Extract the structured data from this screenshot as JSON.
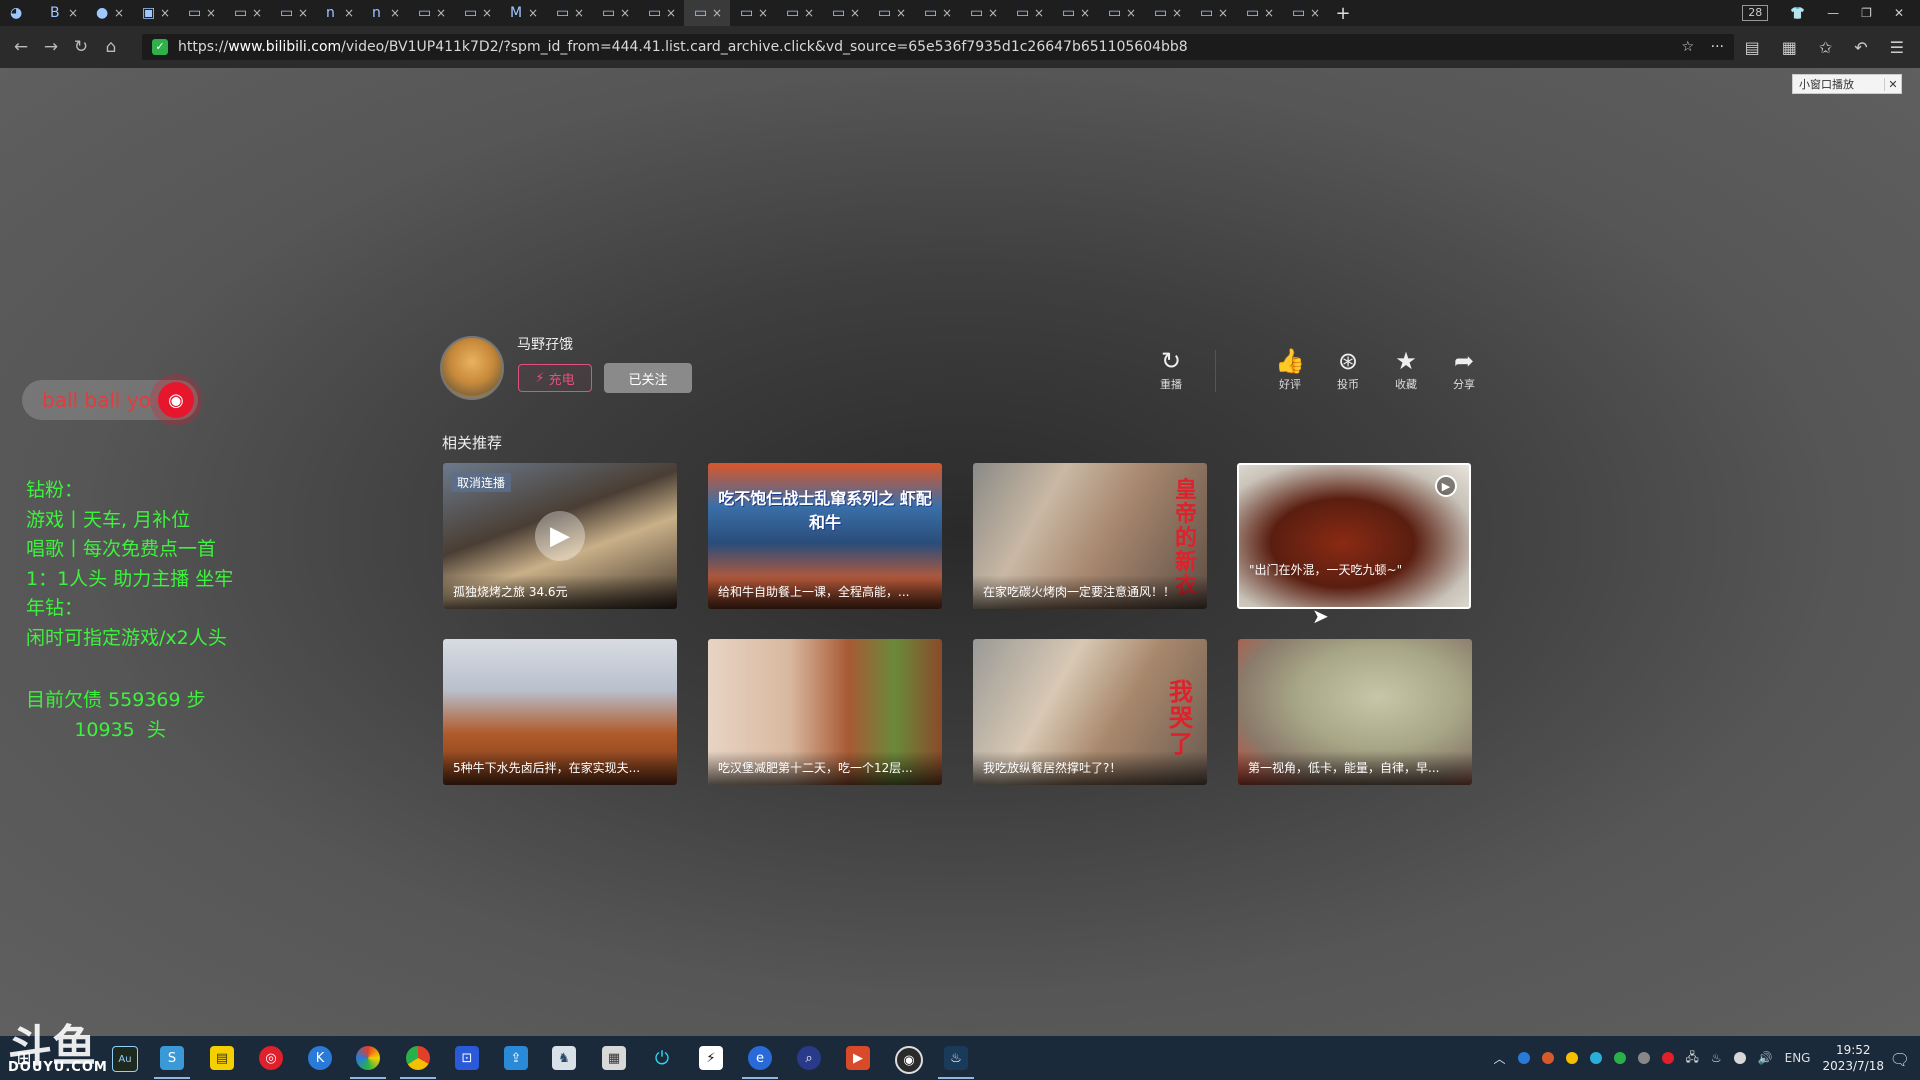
{
  "browser": {
    "tabs": [
      {
        "icon": "user-avatar-icon",
        "label": ""
      },
      {
        "icon": "B",
        "label": "×"
      },
      {
        "icon": "●",
        "label": "×"
      },
      {
        "icon": "▣",
        "label": "×"
      },
      {
        "icon": "▭",
        "label": "×"
      },
      {
        "icon": "▭",
        "label": "×"
      },
      {
        "icon": "▭",
        "label": "×"
      },
      {
        "icon": "n",
        "label": "×"
      },
      {
        "icon": "n",
        "label": "×"
      },
      {
        "icon": "▭",
        "label": "×"
      },
      {
        "icon": "▭",
        "label": "×"
      },
      {
        "icon": "M",
        "label": "×"
      },
      {
        "icon": "▭",
        "label": "×"
      },
      {
        "icon": "▭",
        "label": "×"
      },
      {
        "icon": "▭",
        "label": "×"
      },
      {
        "icon": "▭",
        "label": "×"
      },
      {
        "icon": "▭",
        "label": "×"
      },
      {
        "icon": "▭",
        "label": "×"
      },
      {
        "icon": "▭",
        "label": "×"
      },
      {
        "icon": "▭",
        "label": "×"
      },
      {
        "icon": "▭",
        "label": "×"
      },
      {
        "icon": "▭",
        "label": "×"
      },
      {
        "icon": "▭",
        "label": "×"
      },
      {
        "icon": "▭",
        "label": "×"
      },
      {
        "icon": "▭",
        "label": "×"
      },
      {
        "icon": "▭",
        "label": "×"
      },
      {
        "icon": "▭",
        "label": "×"
      },
      {
        "icon": "▭",
        "label": "×"
      },
      {
        "icon": "▭",
        "label": "×"
      }
    ],
    "tab_count": "28",
    "new_tab": "+",
    "url_scheme": "https://",
    "url_host": "www.bilibili.com",
    "url_path": "/video/BV1UP411k7D2/?spm_id_from=444.41.list.card_archive.click&vd_source=65e536f7935d1c26647b651105604bb8"
  },
  "player": {
    "mini_player_label": "小窗口播放",
    "author_name": "马野孖饿",
    "charge_label": "充电",
    "follow_label": "已关注",
    "actions": [
      {
        "icon": "replay-icon",
        "glyph": "↻",
        "label": "重播"
      },
      {
        "icon": "thumbs-up-icon",
        "glyph": "👍",
        "label": "好评"
      },
      {
        "icon": "coin-icon",
        "glyph": "⊛",
        "label": "投币"
      },
      {
        "icon": "star-icon",
        "glyph": "★",
        "label": "收藏"
      },
      {
        "icon": "share-icon",
        "glyph": "➦",
        "label": "分享"
      }
    ],
    "related_title": "相关推荐",
    "cancel_autoplay": "取消连播",
    "cards": [
      {
        "title": "孤独烧烤之旅 34.6元",
        "overlay": ""
      },
      {
        "title": "给和牛自助餐上一课，全程高能，...",
        "overlay": "吃不饱仨战士乱窜系列之 虾配和牛"
      },
      {
        "title": "在家吃碳火烤肉一定要注意通风！！",
        "overlay": "皇帝的新衣"
      },
      {
        "title": "\"出门在外混，一天吃九顿~\"",
        "overlay": ""
      },
      {
        "title": "5种牛下水先卤后拌，在家实现夫...",
        "overlay": ""
      },
      {
        "title": "吃汉堡减肥第十二天，吃一个12层...",
        "overlay": ""
      },
      {
        "title": "我吃放纵餐居然撑吐了?！",
        "overlay": "我哭了"
      },
      {
        "title": "第一视角，低卡，能量，自律，早...",
        "overlay": ""
      }
    ]
  },
  "stream_overlay": {
    "weibo_text": "ball ball yo",
    "lines": [
      "钻粉：",
      "游戏丨天车, 月补位",
      "唱歌丨每次免费点一首",
      "1：1人头 助力主播 坐牢",
      "年钻：",
      "闲时可指定游戏/x2人头"
    ],
    "debt_lines": [
      "目前欠债 559369 步",
      "        10935  头"
    ]
  },
  "taskbar": {
    "lang": "ENG",
    "time": "19:52",
    "date": "2023/7/18"
  },
  "watermark": {
    "logo": "斗鱼",
    "sub": "DOUYU.COM"
  }
}
